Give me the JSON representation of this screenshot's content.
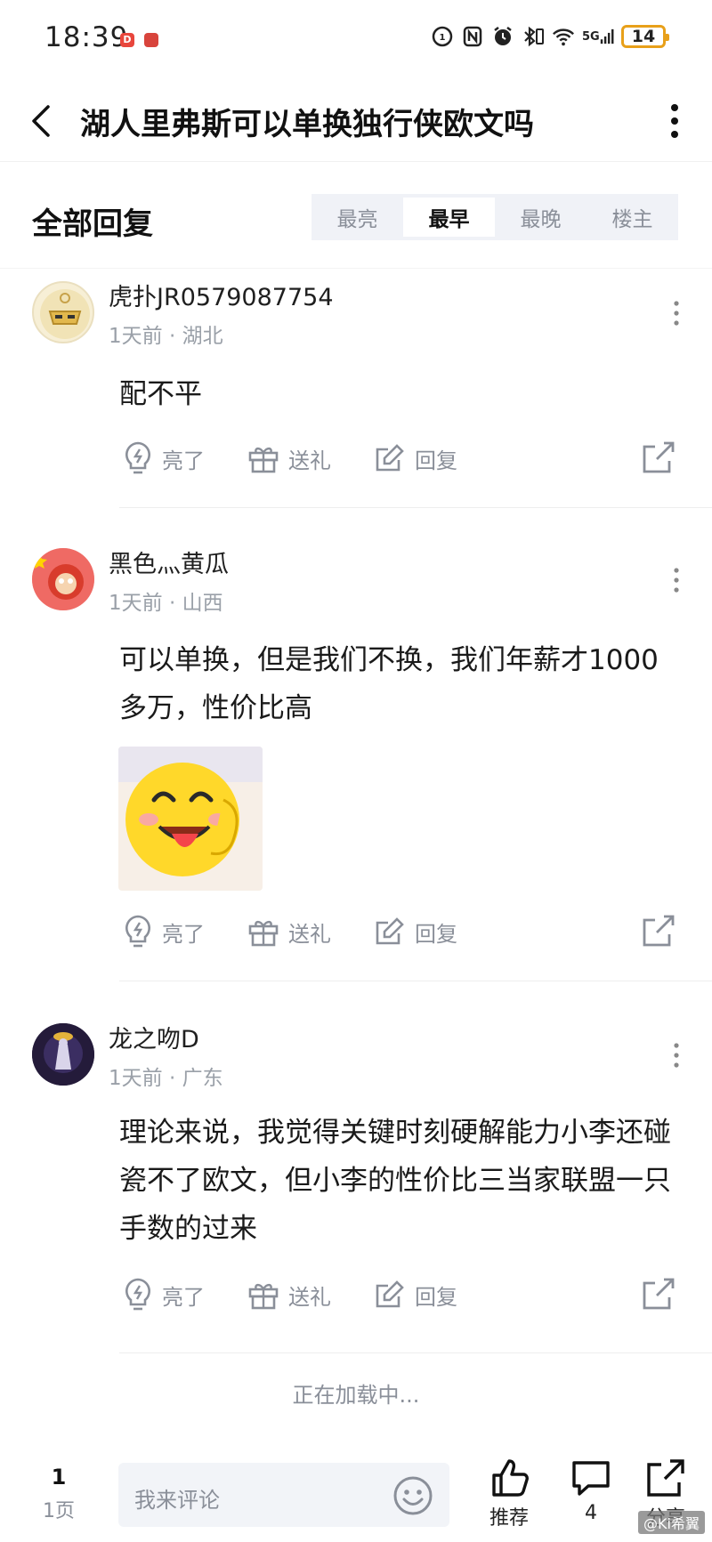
{
  "status_bar": {
    "time": "18:39",
    "app_badges": [
      "D",
      "●"
    ],
    "network": "5G",
    "battery": "14"
  },
  "header": {
    "title": "湖人里弗斯可以单换独行侠欧文吗",
    "back_icon": "chevron-left-icon",
    "more_icon": "vertical-dots-icon"
  },
  "section": {
    "title": "全部回复",
    "sort_tabs": [
      {
        "label": "最亮",
        "active": false
      },
      {
        "label": "最早",
        "active": true
      },
      {
        "label": "最晚",
        "active": false
      },
      {
        "label": "楼主",
        "active": false
      }
    ]
  },
  "actions": {
    "like": "亮了",
    "gift": "送礼",
    "reply": "回复"
  },
  "comments": [
    {
      "username": "虎扑JR0579087754",
      "time": "1天前",
      "location": "湖北",
      "text": "配不平"
    },
    {
      "username": "黑色灬黄瓜",
      "time": "1天前",
      "location": "山西",
      "text": "可以单换，但是我们不换，我们年薪才1000多万，性价比高",
      "has_sticker": true
    },
    {
      "username": "龙之吻D",
      "time": "1天前",
      "location": "广东",
      "text": "理论来说，我觉得关键时刻硬解能力小李还碰瓷不了欧文，但小李的性价比三当家联盟一只手数的过来"
    }
  ],
  "loading_text": "正在加载中...",
  "bottom_bar": {
    "page_number": "1",
    "page_unit": "1页",
    "comment_placeholder": "我来评论",
    "recommend_label": "推荐",
    "comment_count": "4",
    "share_label": "分享"
  },
  "watermark": "@Ki希翼",
  "colors": {
    "text_primary": "#1a1a1a",
    "text_secondary": "#8a8f99",
    "tab_bg": "#f0f2f7",
    "battery": "#e8a01a"
  }
}
